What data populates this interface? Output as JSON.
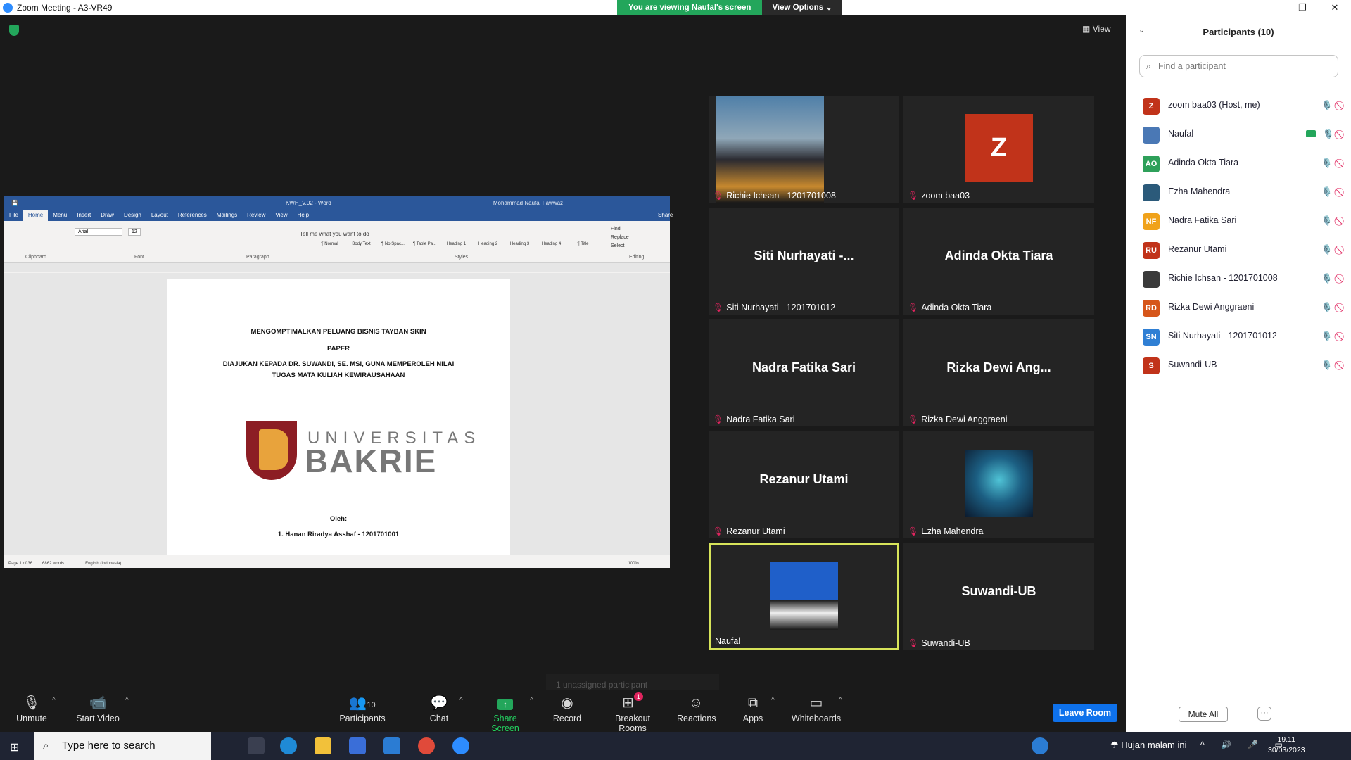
{
  "window": {
    "title": "Zoom Meeting - A3-VR49"
  },
  "banner": {
    "viewing": "You are viewing Naufal's screen",
    "view_options": "View Options"
  },
  "view_label": "View",
  "word": {
    "title": "KWH_V.02 - Word",
    "user": "Mohammad Naufal Fawwaz",
    "tabs": [
      "File",
      "Home",
      "Menu",
      "Insert",
      "Draw",
      "Design",
      "Layout",
      "References",
      "Mailings",
      "Review",
      "View",
      "Help"
    ],
    "tell_me": "Tell me what you want to do",
    "share": "Share",
    "styles": [
      "¶ Normal",
      "Body Text",
      "¶ No Spac...",
      "¶ Table Pa...",
      "Heading 1",
      "Heading 2",
      "Heading 3",
      "Heading 4",
      "¶ Title"
    ],
    "font": "Arial",
    "size": "12",
    "groups": [
      "Clipboard",
      "Font",
      "Paragraph",
      "Styles",
      "Editing"
    ],
    "editing": [
      "Find",
      "Replace",
      "Select"
    ],
    "doc_lines": [
      "MENGOMPTIMALKAN PELUANG BISNIS TAYBAN SKIN",
      "PAPER",
      "DIAJUKAN KEPADA DR. SUWANDI, SE. MSi, GUNA MEMPEROLEH NILAI",
      "TUGAS MATA KULIAH KEWIRAUSAHAAN",
      "Oleh:",
      "1.  Hanan Riradya Asshaf - 1201701001"
    ],
    "logo_line1": "UNIVERSITAS",
    "logo_line2": "BAKRIE",
    "status": {
      "page": "Page 1 of 36",
      "words": "6862 words",
      "lang": "English (Indonesia)",
      "zoom": "100%"
    }
  },
  "tiles": [
    {
      "big": "",
      "caption": "Richie Ichsan - 1201701008",
      "kind": "photo-city",
      "muted": true
    },
    {
      "big": "",
      "caption": "zoom baa03",
      "kind": "avatar-z",
      "avatar": "Z",
      "muted": true
    },
    {
      "big": "Siti Nurhayati -...",
      "caption": "Siti Nurhayati - 1201701012",
      "kind": "text",
      "muted": true
    },
    {
      "big": "Adinda Okta Tiara",
      "caption": "Adinda Okta Tiara",
      "kind": "text",
      "muted": true
    },
    {
      "big": "Nadra Fatika Sari",
      "caption": "Nadra Fatika Sari",
      "kind": "text",
      "muted": true
    },
    {
      "big": "Rizka Dewi Ang...",
      "caption": "Rizka Dewi Anggraeni",
      "kind": "text",
      "muted": true
    },
    {
      "big": "Rezanur Utami",
      "caption": "Rezanur Utami",
      "kind": "text",
      "muted": true
    },
    {
      "big": "",
      "caption": "Ezha Mahendra",
      "kind": "photo-avatar",
      "muted": true
    },
    {
      "big": "",
      "caption": "Naufal",
      "kind": "photo-person",
      "muted": false
    },
    {
      "big": "Suwandi-UB",
      "caption": "Suwandi-UB",
      "kind": "text",
      "muted": true
    }
  ],
  "unassigned": "1 unassigned participant",
  "toolbar": {
    "unmute": "Unmute",
    "start_video": "Start Video",
    "participants": "Participants",
    "participants_count": "10",
    "chat": "Chat",
    "share_screen": "Share Screen",
    "record": "Record",
    "breakout": "Breakout Rooms",
    "breakout_badge": "1",
    "reactions": "Reactions",
    "apps": "Apps",
    "whiteboards": "Whiteboards",
    "leave": "Leave Room"
  },
  "panel": {
    "title": "Participants (10)",
    "search_placeholder": "Find a participant",
    "participants": [
      {
        "initials": "Z",
        "name": "zoom baa03 (Host, me)",
        "color": "#c1331a"
      },
      {
        "initials": "",
        "name": "Naufal",
        "color": "#4a78b5"
      },
      {
        "initials": "AO",
        "name": "Adinda Okta Tiara",
        "color": "#2ea05a"
      },
      {
        "initials": "",
        "name": "Ezha Mahendra",
        "color": "#2b5a7a"
      },
      {
        "initials": "NF",
        "name": "Nadra Fatika Sari",
        "color": "#f0a21a"
      },
      {
        "initials": "RU",
        "name": "Rezanur Utami",
        "color": "#c1331a"
      },
      {
        "initials": "",
        "name": "Richie Ichsan - 1201701008",
        "color": "#3a3a3a"
      },
      {
        "initials": "RD",
        "name": "Rizka Dewi Anggraeni",
        "color": "#d6561a"
      },
      {
        "initials": "SN",
        "name": "Siti Nurhayati - 1201701012",
        "color": "#2f7fd4"
      },
      {
        "initials": "S",
        "name": "Suwandi-UB",
        "color": "#c1331a"
      }
    ],
    "mute_all": "Mute All",
    "more": "···"
  },
  "taskbar": {
    "search": "Type here to search",
    "weather": "Hujan malam ini",
    "time": "19.11",
    "date": "30/03/2023"
  }
}
